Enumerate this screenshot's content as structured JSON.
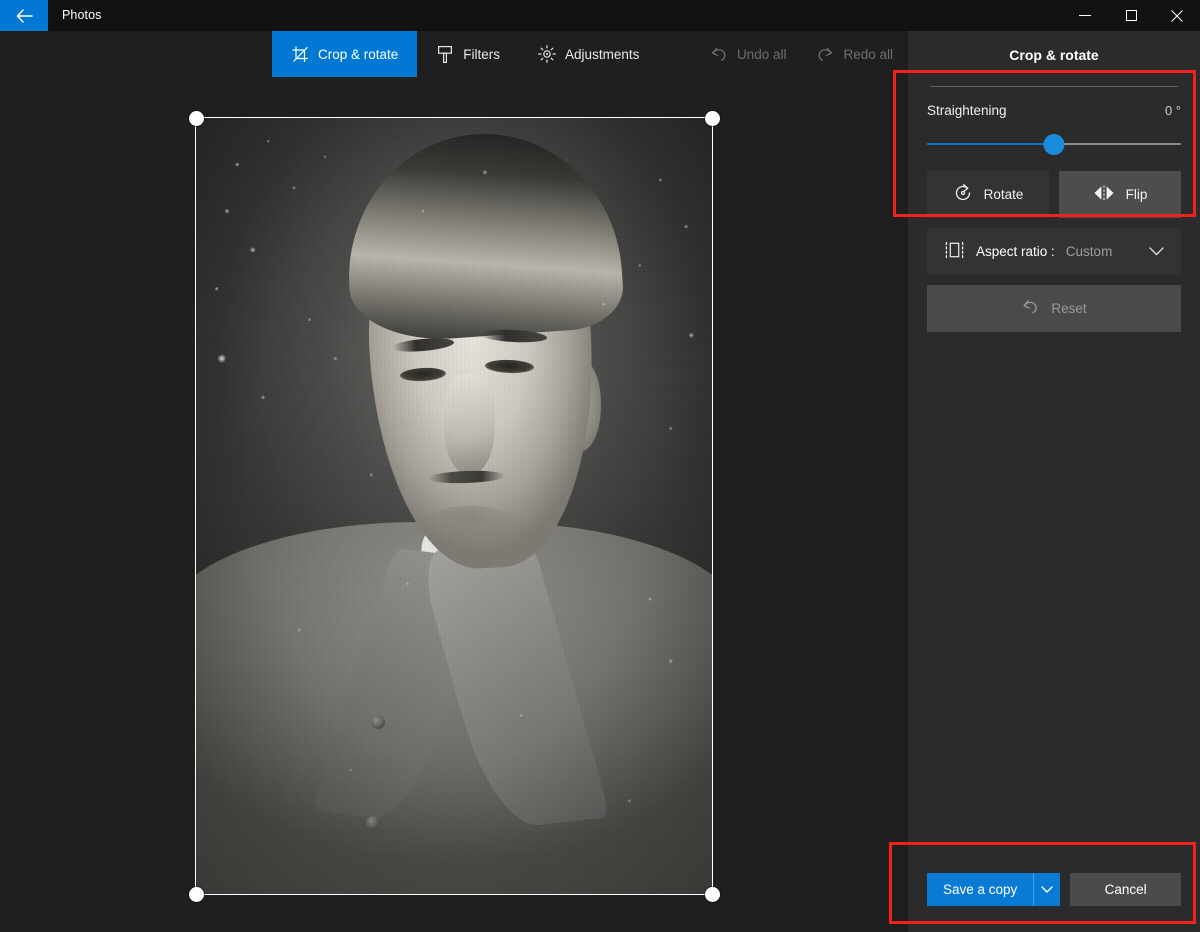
{
  "window": {
    "app_title": "Photos",
    "back_icon": "back-arrow-icon",
    "controls": {
      "minimize_icon": "minimize-icon",
      "maximize_icon": "maximize-icon",
      "close_icon": "close-icon"
    }
  },
  "command_bar": {
    "tabs": [
      {
        "label": "Crop & rotate",
        "icon": "crop-icon",
        "active": true
      },
      {
        "label": "Filters",
        "icon": "filter-icon",
        "active": false
      },
      {
        "label": "Adjustments",
        "icon": "brightness-icon",
        "active": false
      }
    ],
    "history": [
      {
        "label": "Undo all",
        "icon": "undo-icon",
        "enabled": false
      },
      {
        "label": "Redo all",
        "icon": "redo-icon",
        "enabled": false
      }
    ]
  },
  "canvas": {
    "photo_description": "Vintage black and white studio portrait of a young man in a suit with patterned tie",
    "crop_handles": [
      "top-left",
      "top-right",
      "bottom-left",
      "bottom-right"
    ]
  },
  "panel": {
    "title": "Crop & rotate",
    "straightening": {
      "label": "Straightening",
      "value": "0 °",
      "slider_percent": 50
    },
    "rotate": {
      "label": "Rotate",
      "icon": "rotate-icon"
    },
    "flip": {
      "label": "Flip",
      "icon": "flip-icon"
    },
    "aspect_ratio": {
      "label": "Aspect ratio :",
      "value": "Custom",
      "icon": "aspect-ratio-icon",
      "chevron_icon": "chevron-down-icon"
    },
    "reset": {
      "label": "Reset",
      "icon": "reset-icon",
      "enabled": false
    },
    "actions": {
      "save_label": "Save a copy",
      "save_split_icon": "chevron-down-icon",
      "cancel_label": "Cancel"
    }
  },
  "annotations": [
    {
      "name": "straightening-section-highlight",
      "color": "#f32020"
    },
    {
      "name": "save-actions-highlight",
      "color": "#f32020"
    }
  ],
  "colors": {
    "accent": "#0078d4",
    "panel_bg": "#2b2b2b",
    "canvas_bg": "#1f1f1f",
    "titlebar_bg": "#111111",
    "annotation": "#f32020"
  }
}
